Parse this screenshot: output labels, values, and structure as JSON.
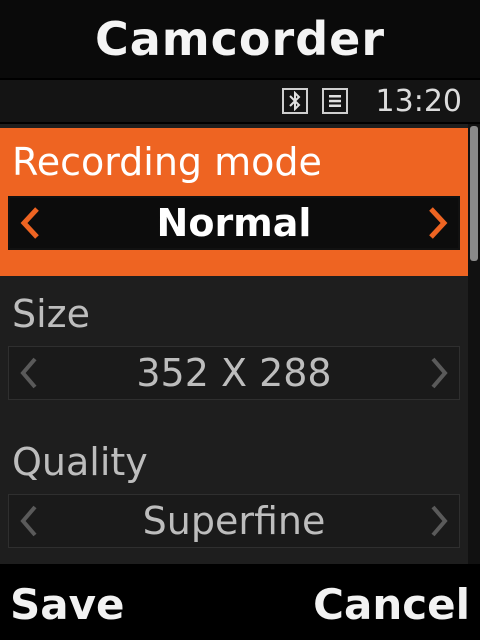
{
  "header": {
    "title": "Camcorder"
  },
  "status": {
    "icons": [
      "bluetooth-icon",
      "menu-list-icon"
    ],
    "time": "13:20"
  },
  "settings": [
    {
      "label": "Recording mode",
      "value": "Normal",
      "active": true
    },
    {
      "label": "Size",
      "value": "352 X 288",
      "active": false
    },
    {
      "label": "Quality",
      "value": "Superfine",
      "active": false
    }
  ],
  "softkeys": {
    "left": "Save",
    "right": "Cancel"
  },
  "colors": {
    "accent": "#ee6422",
    "background": "#000000",
    "panel": "#1e1e1e"
  }
}
